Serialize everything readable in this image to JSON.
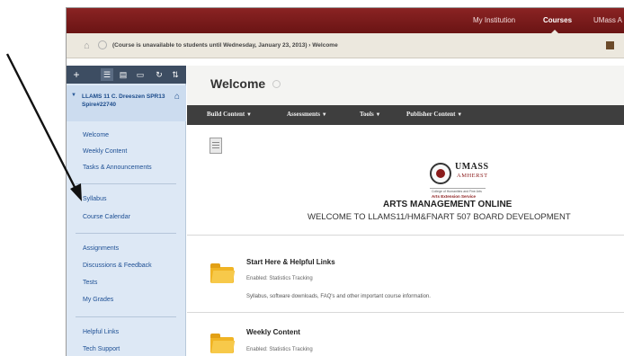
{
  "topnav": {
    "my_institution": "My Institution",
    "courses": "Courses",
    "umass": "UMass A"
  },
  "breadcrumb": {
    "text": "(Course is unavailable to students until Wednesday, January 23, 2013) › Welcome"
  },
  "sidebar": {
    "toolbar_add": "+",
    "course_title": "LLAMS 11 C. Dreeszen SPR13 Spire#22740",
    "groups": [
      [
        "Welcome",
        "Weekly Content",
        "Tasks & Announcements"
      ],
      [
        "Syllabus",
        "Course Calendar"
      ],
      [
        "Assignments",
        "Discussions & Feedback",
        "Tests",
        "My Grades"
      ],
      [
        "Helpful Links",
        "Tech Support"
      ]
    ]
  },
  "main": {
    "title": "Welcome",
    "action_bar": {
      "build_content": "Build Content",
      "assessments": "Assessments",
      "tools": "Tools",
      "publisher_content": "Publisher Content"
    },
    "banner": {
      "umass": "UMASS",
      "amherst": "AMHERST",
      "college": "College of Humanities and Fine Arts",
      "extension": "Arts Extension Service",
      "heading": "ARTS MANAGEMENT ONLINE",
      "welcome": "WELCOME TO LLAMS11/HM&FNART 507 BOARD DEVELOPMENT"
    },
    "items": [
      {
        "title": "Start Here & Helpful Links",
        "meta": "Enabled:  Statistics Tracking",
        "desc": "Syllabus, software downloads, FAQ's and other important course information."
      },
      {
        "title": "Weekly Content",
        "meta": "Enabled:  Statistics Tracking"
      }
    ]
  },
  "icons": {
    "home": "home-icon",
    "refresh": "refresh-icon",
    "folder": "folder-icon",
    "arrow": "annotation-arrow"
  },
  "colors": {
    "topnav": "#7a1a1a",
    "sidebar": "#dde8f5",
    "action_bar": "#3e3e3e",
    "link": "#1d4f94"
  }
}
